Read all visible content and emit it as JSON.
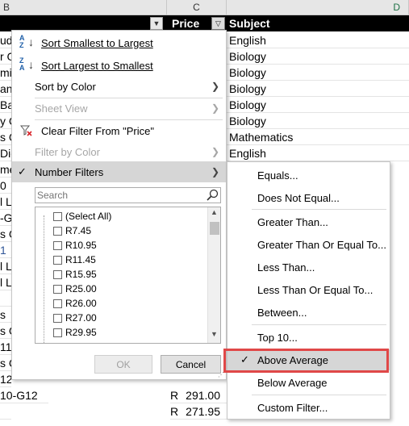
{
  "columns": {
    "b": "B",
    "c": "C",
    "d": "D"
  },
  "table_header": {
    "price": "Price",
    "subject": "Subject"
  },
  "left_fragments": [
    "udi",
    "r G",
    "mi",
    "an",
    "Bas",
    "y C",
    "s G",
    "Dic",
    "me",
    "0",
    "l Li",
    "-G1",
    "s G",
    "1",
    "l Li",
    "l Li",
    "",
    "s",
    "s G",
    "11",
    "s C",
    "12",
    "10-G12",
    ""
  ],
  "subjects": [
    "English",
    "Biology",
    "Biology",
    "Biology",
    "Biology",
    "Biology",
    "Mathematics",
    "English"
  ],
  "bottom_rows": [
    {
      "currency": "R",
      "value": "291.00"
    },
    {
      "currency": "R",
      "value": "271.95"
    }
  ],
  "filter_menu": {
    "items": [
      {
        "label": "Sort Smallest to Largest",
        "icon": "sort-ascending-icon",
        "disabled": false
      },
      {
        "label": "Sort Largest to Smallest",
        "icon": "sort-descending-icon",
        "disabled": false
      },
      {
        "label": "Sort by Color",
        "disabled": false,
        "submenu": true
      },
      {
        "label": "Sheet View",
        "disabled": true,
        "submenu": true
      },
      {
        "label": "Clear Filter From \"Price\"",
        "icon": "clear-filter-icon",
        "disabled": true
      },
      {
        "label": "Filter by Color",
        "disabled": true,
        "submenu": true
      },
      {
        "label": "Number Filters",
        "checked": true,
        "submenu": true
      }
    ],
    "search_placeholder": "Search",
    "values": [
      "(Select All)",
      "R7.45",
      "R10.95",
      "R11.45",
      "R15.95",
      "R25.00",
      "R26.00",
      "R27.00",
      "R29.95"
    ],
    "ok_label": "OK",
    "cancel_label": "Cancel"
  },
  "number_filters": {
    "items": [
      "Equals...",
      "Does Not Equal...",
      "Greater Than...",
      "Greater Than Or Equal To...",
      "Less Than...",
      "Less Than Or Equal To...",
      "Between...",
      "Top 10...",
      "Above Average",
      "Below Average",
      "Custom Filter..."
    ],
    "selected": "Above Average",
    "highlight_color": "#e04848"
  }
}
